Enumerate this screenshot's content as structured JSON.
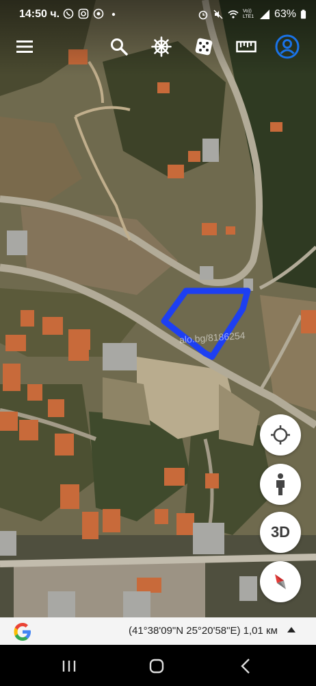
{
  "status_bar": {
    "time": "14:50 ч.",
    "battery": "63%",
    "network": "Vo)) LTE1"
  },
  "toolbar": {
    "icons": [
      "menu-icon",
      "search-icon",
      "ship-wheel-icon",
      "dice-icon",
      "ruler-icon",
      "account-icon"
    ]
  },
  "map": {
    "watermark": "alo.bg/8186254",
    "outline_color": "#1d3ff2"
  },
  "fabs": {
    "locate_icon": "crosshair-icon",
    "pegman_icon": "pegman-icon",
    "view_3d_label": "3D",
    "compass_icon": "compass-icon"
  },
  "info_bar": {
    "coordinates": "(41°38'09\"N 25°20'58\"E) 1,01 км"
  },
  "nav_bar": {
    "icons": [
      "recent-apps-icon",
      "home-icon",
      "back-icon"
    ]
  },
  "colors": {
    "accent_blue": "#1a73e8",
    "outline_blue": "#1d3ff2"
  }
}
